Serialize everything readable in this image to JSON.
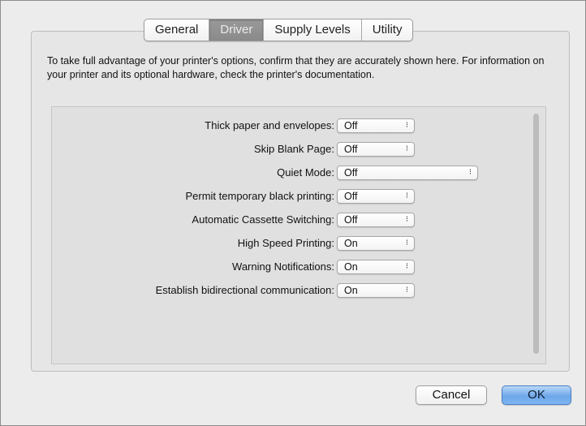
{
  "tabs": [
    {
      "label": "General",
      "selected": false
    },
    {
      "label": "Driver",
      "selected": true
    },
    {
      "label": "Supply Levels",
      "selected": false
    },
    {
      "label": "Utility",
      "selected": false
    }
  ],
  "description": "To take full advantage of your printer's options, confirm that they are accurately shown here. For information on your printer and its optional hardware, check the printer's documentation.",
  "options": [
    {
      "label": "Thick paper and envelopes:",
      "value": "Off"
    },
    {
      "label": "Skip Blank Page:",
      "value": "Off"
    },
    {
      "label": "Quiet Mode:",
      "value": "Off"
    },
    {
      "label": "Permit temporary black printing:",
      "value": "Off"
    },
    {
      "label": "Automatic Cassette Switching:",
      "value": "Off"
    },
    {
      "label": "High Speed Printing:",
      "value": "On"
    },
    {
      "label": "Warning Notifications:",
      "value": "On"
    },
    {
      "label": "Establish bidirectional communication:",
      "value": "On"
    }
  ],
  "popup_arrow_glyph": "⁝",
  "buttons": {
    "cancel": "Cancel",
    "ok": "OK"
  },
  "colors": {
    "selected_tab": "#8f8f8f",
    "default_button": "#6ea8ea"
  }
}
